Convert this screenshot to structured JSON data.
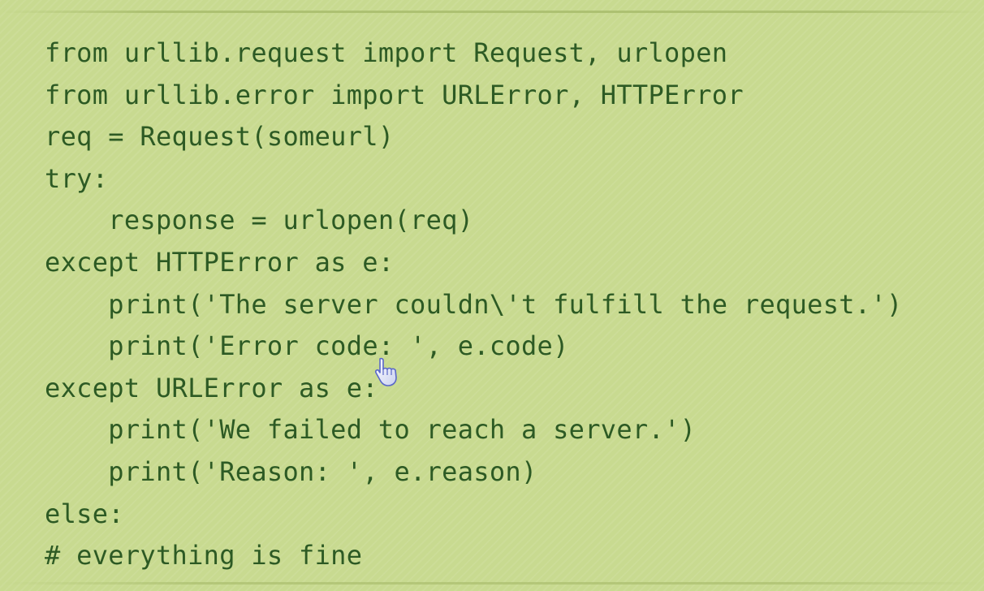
{
  "code": {
    "lines": [
      {
        "indent": "",
        "text": "from urllib.request import Request, urlopen"
      },
      {
        "indent": "",
        "text": "from urllib.error import URLError, HTTPError"
      },
      {
        "indent": "",
        "text": "req = Request(someurl)"
      },
      {
        "indent": "",
        "text": "try:"
      },
      {
        "indent": "    ",
        "text": "response = urlopen(req)"
      },
      {
        "indent": "",
        "text": "except HTTPError as e:"
      },
      {
        "indent": "    ",
        "text": "print('The server couldn\\'t fulfill the request.')"
      },
      {
        "indent": "    ",
        "text": "print('Error code: ', e.code)"
      },
      {
        "indent": "",
        "text": "except URLError as e:"
      },
      {
        "indent": "    ",
        "text": "print('We failed to reach a server.')"
      },
      {
        "indent": "    ",
        "text": "print('Reason: ', e.reason)"
      },
      {
        "indent": "",
        "text": "else:"
      },
      {
        "indent": "",
        "text": "# everything is fine"
      }
    ]
  },
  "cursor": {
    "icon": "hand-pointer-icon"
  },
  "colors": {
    "background": "#c8da90",
    "code_text": "#2d5a24"
  }
}
